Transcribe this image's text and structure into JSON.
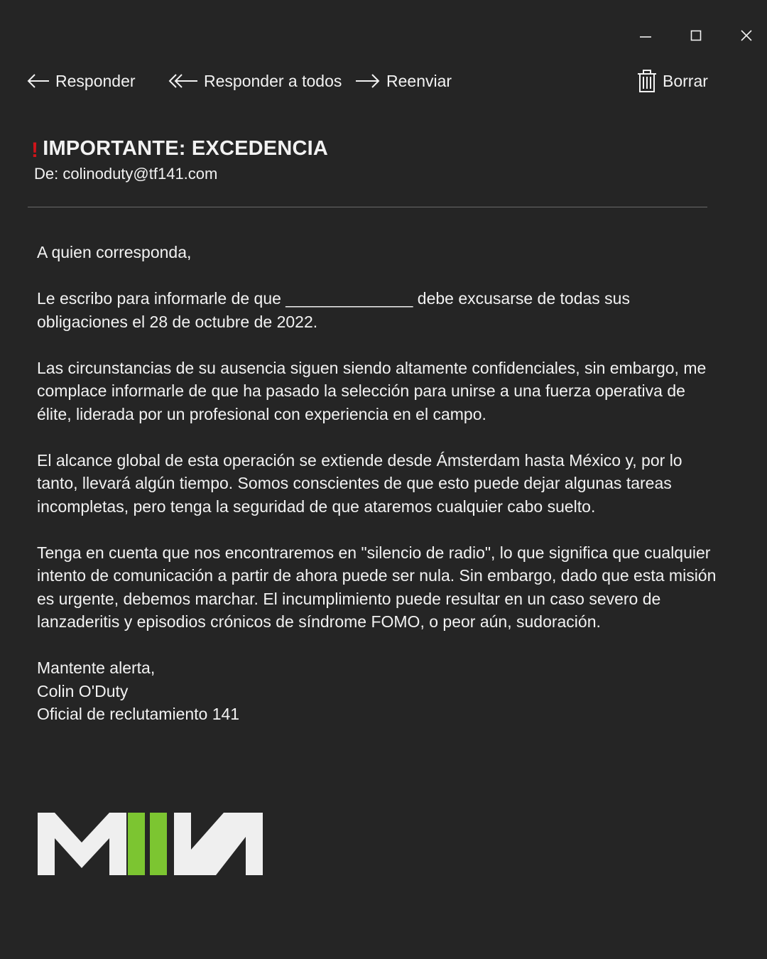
{
  "window_controls": {
    "minimize_icon": "minimize-icon",
    "maximize_icon": "maximize-icon",
    "close_icon": "close-icon"
  },
  "toolbar": {
    "reply_label": "Responder",
    "reply_all_label": "Responder a todos",
    "forward_label": "Reenviar",
    "delete_label": "Borrar"
  },
  "email": {
    "importance_marker": "!",
    "subject": "IMPORTANTE: EXCEDENCIA",
    "from": "De: colinoduty@tf141.com",
    "greeting": "A quien corresponda,",
    "paragraphs": [
      "Le escribo para informarle de que ______________ debe excusarse de todas sus obligaciones el 28 de octubre de 2022.",
      "Las circunstancias de su ausencia siguen siendo altamente confidenciales, sin embargo, me complace informarle de que ha pasado la selección para unirse a una fuerza operativa de élite, liderada por un profesional con experiencia en el campo.",
      "El alcance global de esta operación se extiende desde Ámsterdam hasta México y, por lo tanto, llevará algún tiempo. Somos conscientes de que esto puede dejar algunas tareas incompletas, pero tenga la seguridad de que ataremos cualquier cabo suelto.",
      "Tenga en cuenta que nos encontraremos en \"silencio de radio\", lo que significa que cualquier intento de comunicación a partir de ahora puede ser nula. Sin embargo, dado que esta misión es urgente, debemos marchar. El incumplimiento puede resultar en un caso severo de lanzaderitis y episodios crónicos de síndrome FOMO, o peor aún, sudoración."
    ],
    "signature": {
      "closing": "Mantente alerta,",
      "name": "Colin O'Duty",
      "title": "Oficial de reclutamiento 141"
    }
  },
  "logo": {
    "name": "MWII",
    "colors": {
      "white": "#efefef",
      "green": "#7cc531"
    }
  },
  "colors": {
    "background": "#252525",
    "text": "#f2f2f2",
    "importance": "#d0141a",
    "divider": "#6a6a6a"
  }
}
